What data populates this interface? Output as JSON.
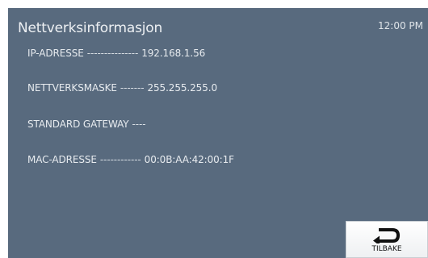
{
  "header": {
    "title": "Nettverksinformasjon",
    "time": "12:00 PM"
  },
  "network_info": [
    {
      "label": "IP-ADRESSE",
      "dashes": "---------------",
      "value": "192.168.1.56"
    },
    {
      "label": "NETTVERKSMASKE",
      "dashes": "-------",
      "value": "255.255.255.0"
    },
    {
      "label": "STANDARD GATEWAY",
      "dashes": "----",
      "value": ""
    },
    {
      "label": "MAC-ADRESSE",
      "dashes": "------------",
      "value": "00:0B:AA:42:00:1F"
    }
  ],
  "footer": {
    "back_label": "TILBAKE",
    "back_icon": "return-arrow-icon"
  },
  "colors": {
    "background": "#586a7e",
    "text": "#e7ebef",
    "button": "#ffffff"
  }
}
